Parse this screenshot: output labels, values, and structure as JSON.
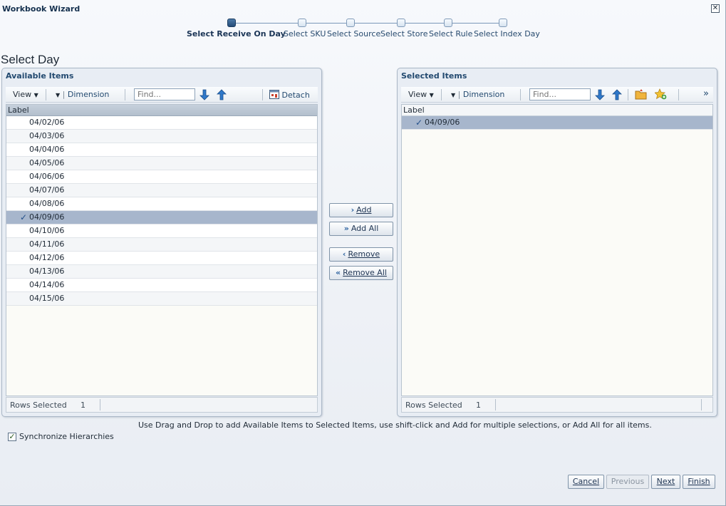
{
  "window": {
    "title": "Workbook Wizard",
    "close_glyph": "✕"
  },
  "train": {
    "steps": [
      {
        "label": "Select Receive On Day",
        "current": true
      },
      {
        "label": "Select SKU",
        "current": false
      },
      {
        "label": "Select Source",
        "current": false
      },
      {
        "label": "Select Store",
        "current": false
      },
      {
        "label": "Select Rule",
        "current": false
      },
      {
        "label": "Select Index Day",
        "current": false
      }
    ]
  },
  "page": {
    "heading": "Select Day"
  },
  "available": {
    "title": "Available Items",
    "toolbar": {
      "view": "View",
      "dimension": "Dimension",
      "find_placeholder": "Find...",
      "detach": "Detach"
    },
    "column_header": "Label",
    "rows": [
      "04/02/06",
      "04/03/06",
      "04/04/06",
      "04/05/06",
      "04/06/06",
      "04/07/06",
      "04/08/06",
      "04/09/06",
      "04/10/06",
      "04/11/06",
      "04/12/06",
      "04/13/06",
      "04/14/06",
      "04/15/06"
    ],
    "selected_row": "04/09/06",
    "footer": {
      "label": "Rows Selected",
      "value": "1"
    }
  },
  "selected": {
    "title": "Selected Items",
    "toolbar": {
      "view": "View",
      "dimension": "Dimension",
      "find_placeholder": "Find...",
      "overflow": "»"
    },
    "column_header": "Label",
    "rows": [
      "04/09/06"
    ],
    "footer": {
      "label": "Rows Selected",
      "value": "1"
    }
  },
  "shuttle": {
    "add": "Add",
    "add_all": "Add All",
    "remove": "Remove",
    "remove_all": "Remove All"
  },
  "hint": "Use Drag and Drop to add Available Items to Selected Items, use shift-click and Add for multiple selections, or Add All for all items.",
  "sync": {
    "label": "Synchronize Hierarchies",
    "checked": true
  },
  "nav": {
    "cancel": "Cancel",
    "previous": "Previous",
    "next": "Next",
    "finish": "Finish"
  },
  "colors": {
    "accent": "#234a70",
    "selected_row": "#a7b6cc",
    "arrow_blue": "#2f78c9"
  },
  "icons": {
    "check": "✓",
    "detach": "detach-icon",
    "move_down": "arrow-down-icon",
    "move_up": "arrow-up-icon",
    "add_folder": "folder-icon",
    "favorite": "star-add-icon"
  }
}
